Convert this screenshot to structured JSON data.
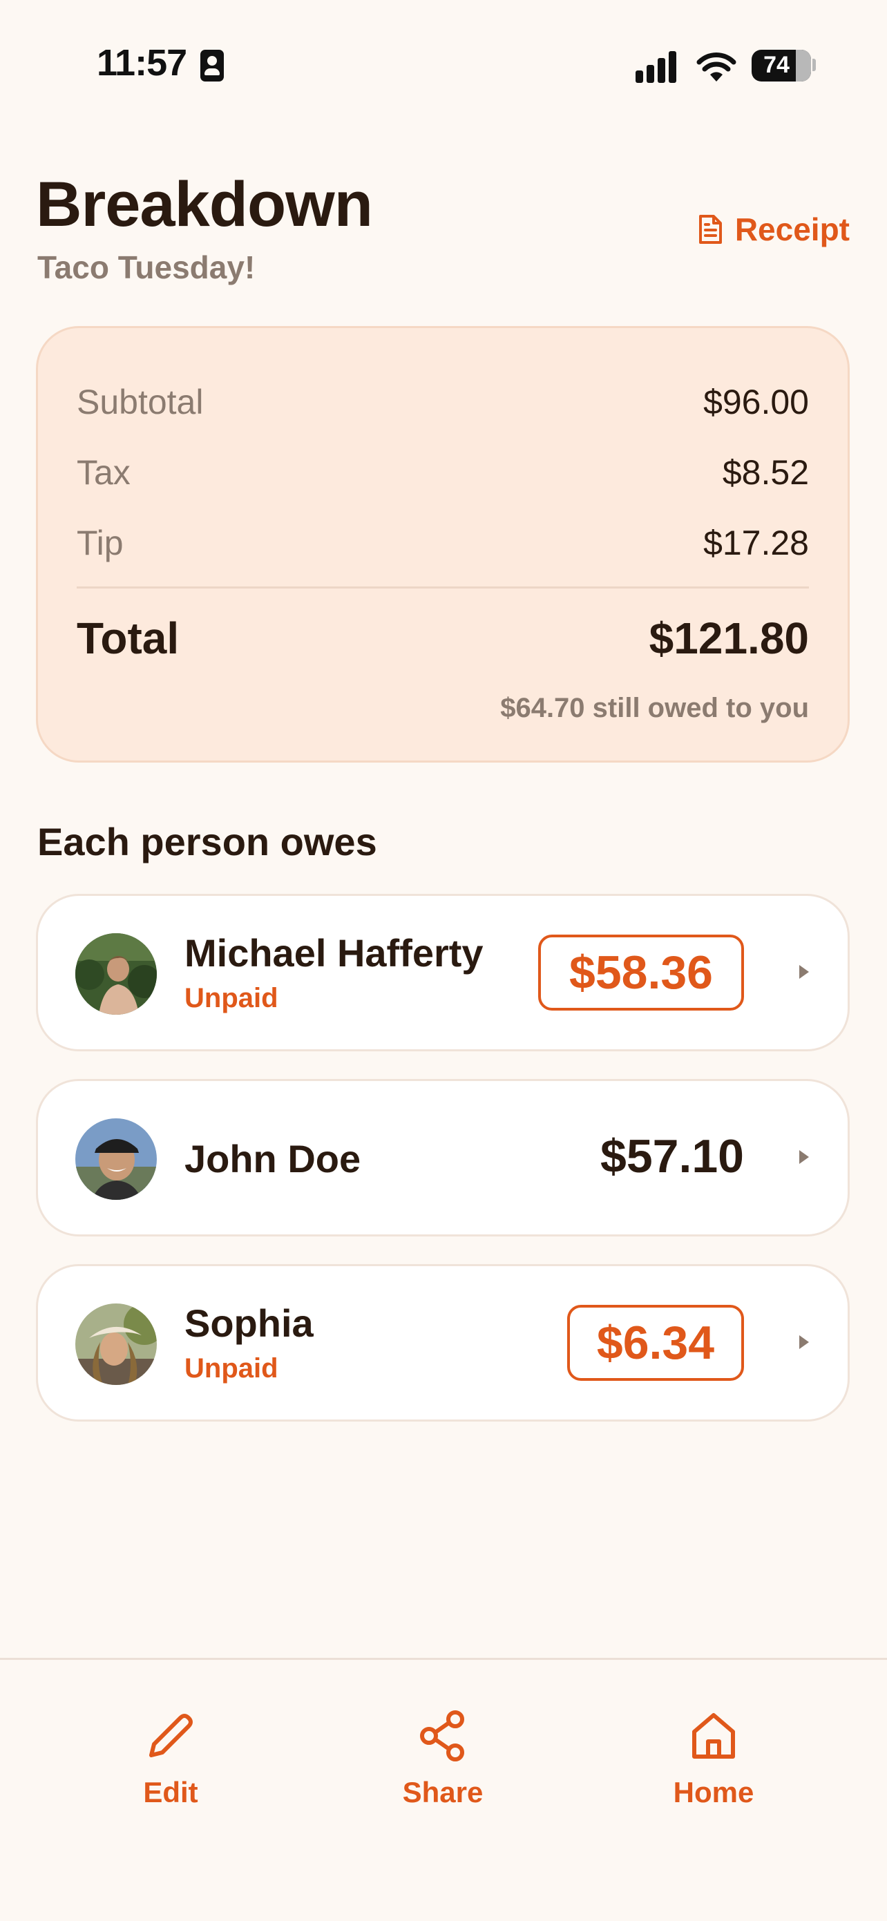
{
  "status_bar": {
    "time": "11:57",
    "battery": "74"
  },
  "header": {
    "title": "Breakdown",
    "subtitle": "Taco Tuesday!",
    "receipt_label": "Receipt"
  },
  "summary": {
    "subtotal_label": "Subtotal",
    "subtotal_value": "$96.00",
    "tax_label": "Tax",
    "tax_value": "$8.52",
    "tip_label": "Tip",
    "tip_value": "$17.28",
    "total_label": "Total",
    "total_value": "$121.80",
    "owed_note": "$64.70 still owed to you"
  },
  "people_section": {
    "title": "Each person owes",
    "people": [
      {
        "name": "Michael Hafferty",
        "status": "Unpaid",
        "amount": "$58.36"
      },
      {
        "name": "John Doe",
        "status": "",
        "amount": "$57.10"
      },
      {
        "name": "Sophia",
        "status": "Unpaid",
        "amount": "$6.34"
      }
    ]
  },
  "bottom_nav": {
    "edit_label": "Edit",
    "share_label": "Share",
    "home_label": "Home"
  },
  "colors": {
    "accent": "#e0581a",
    "background": "#fdf8f3",
    "card": "#fdeadd",
    "text": "#2a1a10",
    "muted": "#8b7b70"
  },
  "icons": [
    "contact-card-icon",
    "signal-icon",
    "wifi-icon",
    "battery-icon",
    "receipt-icon",
    "chevron-right-icon",
    "pencil-icon",
    "share-icon",
    "home-icon"
  ]
}
